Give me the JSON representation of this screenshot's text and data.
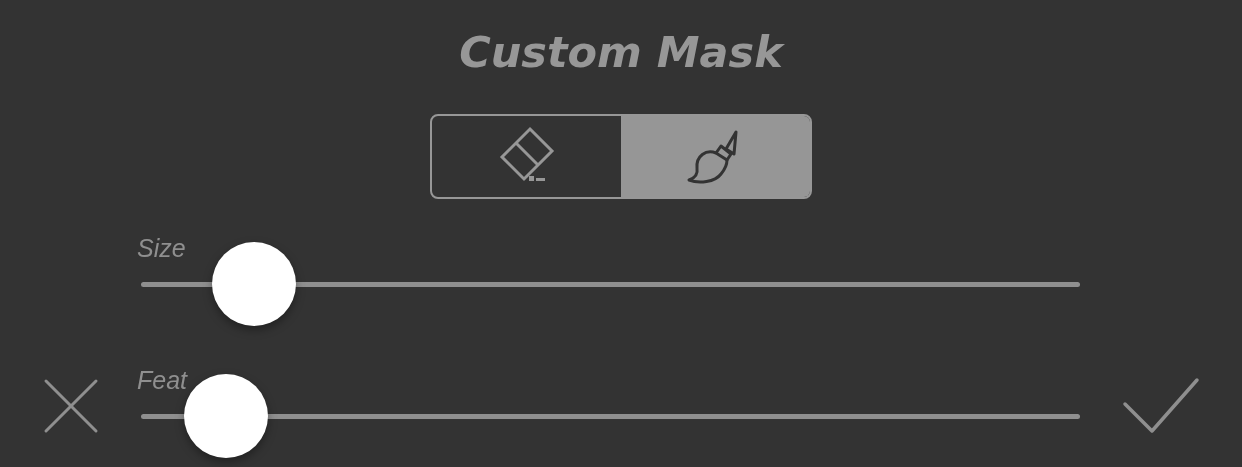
{
  "title": "Custom Mask",
  "modes": [
    {
      "kind": "eraser",
      "selected": false
    },
    {
      "kind": "brush",
      "selected": true
    }
  ],
  "sliders": [
    {
      "label": "Size",
      "level": 0.12
    },
    {
      "label": "Feat",
      "level": 0.09
    }
  ]
}
